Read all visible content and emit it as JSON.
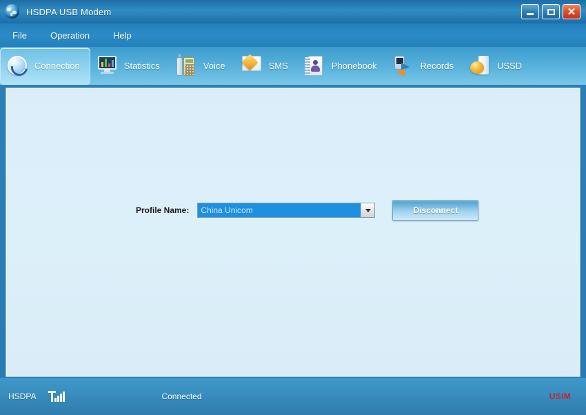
{
  "window": {
    "title": "HSDPA USB Modem",
    "app_icon": "globe-icon",
    "controls": {
      "minimize": "–",
      "maximize": "□",
      "close": "✕"
    }
  },
  "menu": {
    "items": [
      {
        "label": "File"
      },
      {
        "label": "Operation"
      },
      {
        "label": "Help"
      }
    ]
  },
  "toolbar": {
    "tabs": [
      {
        "label": "Connection",
        "icon": "connection-refresh-icon",
        "active": true
      },
      {
        "label": "Statistics",
        "icon": "statistics-monitor-chart-icon",
        "active": false
      },
      {
        "label": "Voice",
        "icon": "voice-phone-icon",
        "active": false
      },
      {
        "label": "SMS",
        "icon": "sms-envelope-icon",
        "active": false
      },
      {
        "label": "Phonebook",
        "icon": "phonebook-contacts-icon",
        "active": false
      },
      {
        "label": "Records",
        "icon": "records-transfer-icon",
        "active": false
      },
      {
        "label": "USSD",
        "icon": "ussd-sphere-icon",
        "active": false
      }
    ]
  },
  "main": {
    "profile": {
      "label": "Profile Name:",
      "selected_value": "China Unicom",
      "dropdown_icon": "chevron-down-icon"
    },
    "connect_button": {
      "label": "Disconnect"
    }
  },
  "status_bar": {
    "network_type": "HSDPA",
    "signal_icon": "signal-strength-icon",
    "connection_state": "Connected",
    "sim_type": "USIM"
  },
  "colors": {
    "title_bar": "#2a83bb",
    "menu_bar": "#2480bb",
    "toolbar_top": "#3d9ccd",
    "toolbar_bottom": "#79c7e8",
    "content_bg": "#dcf0fa",
    "accent_blue": "#1e90e0",
    "close_button": "#e2512a",
    "usim_red": "#c4242b",
    "status_bar": "#3a8ec0"
  }
}
